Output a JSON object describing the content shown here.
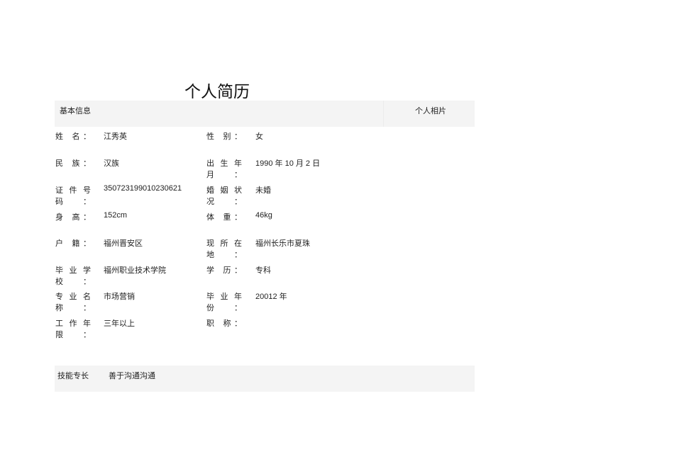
{
  "title": "个人简历",
  "basic_info_label": "基本信息",
  "photo_label": "个人相片",
  "rows": [
    {
      "l1": "姓 名：",
      "v1": "江秀英",
      "l2": "性 别：",
      "v2": "女"
    },
    {
      "l1": "民 族：",
      "v1": "汉族",
      "l2": "出生年月：",
      "v2": "1990 年 10 月 2 日"
    },
    {
      "l1": "证件号码：",
      "v1": "350723199010230621",
      "l2": "婚姻状况：",
      "v2": "未婚"
    },
    {
      "l1": "身 高：",
      "v1": "152cm",
      "l2": "体 重：",
      "v2": "46kg"
    },
    {
      "l1": "户 籍：",
      "v1": "福州晋安区",
      "l2": "现所在地：",
      "v2": "福州长乐市夏珠"
    },
    {
      "l1": "毕业学校：",
      "v1": "福州职业技术学院",
      "l2": "学 历：",
      "v2": "专科"
    },
    {
      "l1": "专业名称：",
      "v1": "市场营销",
      "l2": "毕业年份：",
      "v2": "20012 年"
    },
    {
      "l1": "工作年限：",
      "v1": "三年以上",
      "l2": "职 称：",
      "v2": ""
    }
  ],
  "skills": {
    "label": "技能专长",
    "value": "善于沟通沟通"
  }
}
